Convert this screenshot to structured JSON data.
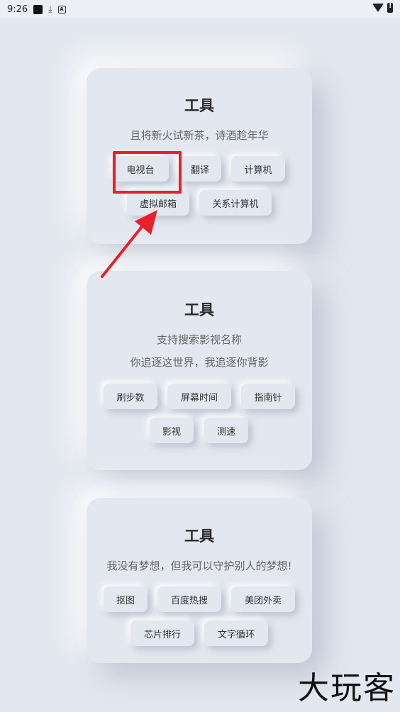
{
  "status_bar": {
    "time": "9:26"
  },
  "cards": [
    {
      "title": "工具",
      "subtitles": [
        "且将新火试新茶，诗酒趁年华"
      ],
      "buttons": [
        "电视台",
        "翻译",
        "计算机",
        "虚拟邮箱",
        "关系计算机"
      ]
    },
    {
      "title": "工具",
      "subtitles": [
        "支持搜索影视名称",
        "你追逐这世界，我追逐你背影"
      ],
      "buttons": [
        "刷步数",
        "屏幕时间",
        "指南针",
        "影视",
        "测速"
      ]
    },
    {
      "title": "工具",
      "subtitles": [
        "我没有梦想，但我可以守护别人的梦想!"
      ],
      "buttons": [
        "抠图",
        "百度热搜",
        "美团外卖",
        "芯片排行",
        "文字循环"
      ]
    }
  ],
  "watermark": "大玩客",
  "annotation_color": "#e8202a"
}
